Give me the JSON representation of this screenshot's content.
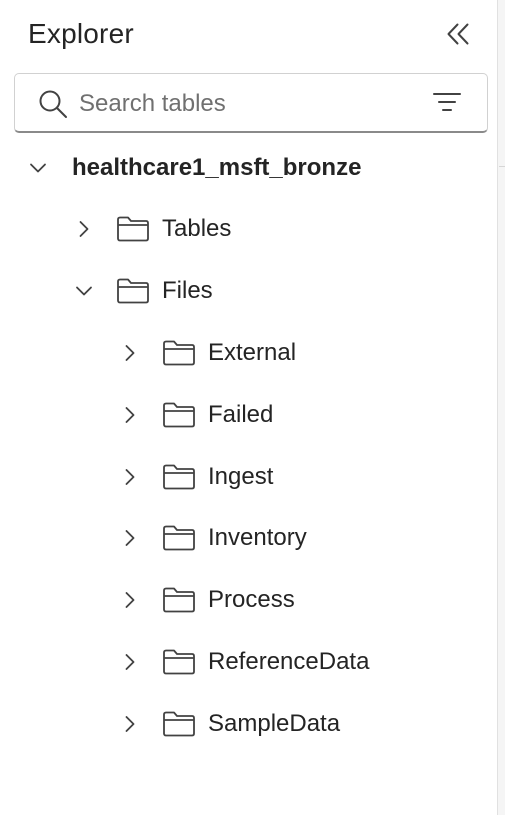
{
  "explorer": {
    "title": "Explorer",
    "collapse_icon": "double-chevron-left-icon"
  },
  "search": {
    "placeholder": "Search tables",
    "value": "",
    "search_icon": "search-icon",
    "filter_icon": "filter-icon"
  },
  "tree": {
    "root": {
      "label": "healthcare1_msft_bronze",
      "expanded": true
    },
    "tables": {
      "label": "Tables",
      "expanded": false
    },
    "files": {
      "label": "Files",
      "expanded": true,
      "children": [
        {
          "label": "External"
        },
        {
          "label": "Failed"
        },
        {
          "label": "Ingest"
        },
        {
          "label": "Inventory"
        },
        {
          "label": "Process"
        },
        {
          "label": "ReferenceData"
        },
        {
          "label": "SampleData"
        }
      ]
    }
  }
}
